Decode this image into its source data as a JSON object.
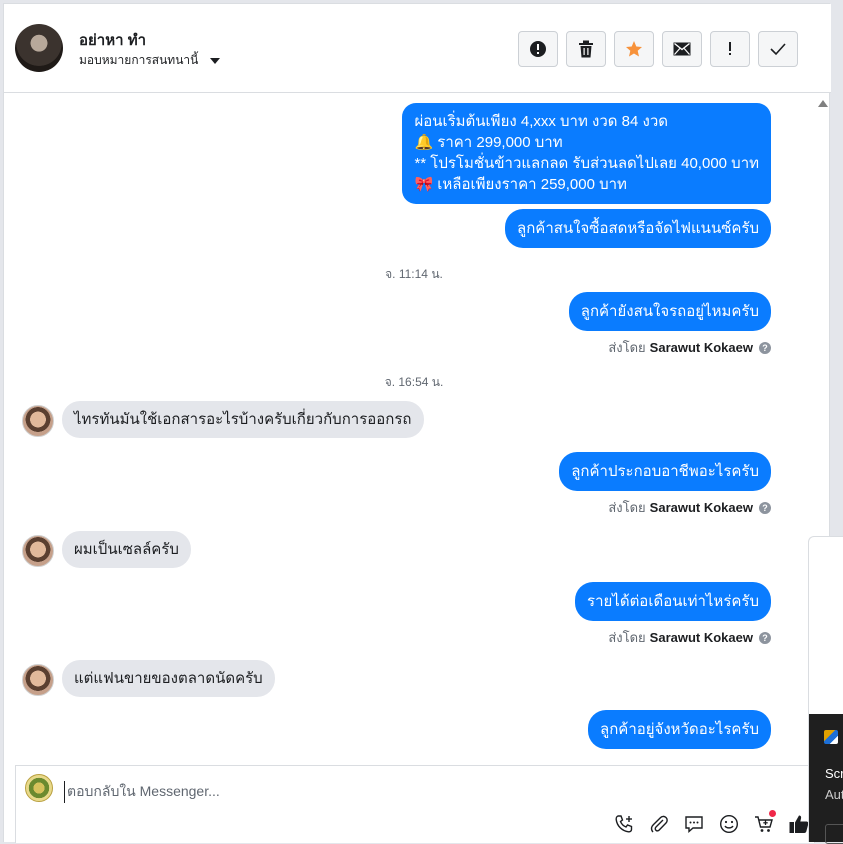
{
  "header": {
    "name": "อย่าหา ทำ",
    "subtitle": "มอบหมายการสนทนานี้",
    "tools": [
      {
        "name": "report-button",
        "icon": "exclamation-circle-icon"
      },
      {
        "name": "delete-button",
        "icon": "trash-icon"
      },
      {
        "name": "star-button",
        "icon": "star-icon"
      },
      {
        "name": "mark-unread-button",
        "icon": "envelope-icon"
      },
      {
        "name": "flag-button",
        "icon": "exclamation-icon"
      },
      {
        "name": "done-button",
        "icon": "checkmark-icon"
      }
    ],
    "colors": {
      "star": "#f7923b"
    }
  },
  "messages": [
    {
      "dir": "out",
      "lines": [
        "ผ่อนเริ่มต้นเพียง 4,xxx บาท งวด 84 งวด",
        "🔔 ราคา 299,000 บาท",
        "** โปรโมชั่นข้าวแลกลด รับส่วนลดไปเลย 40,000 บาท",
        "🎀  เหลือเพียงราคา 259,000 บาท"
      ]
    },
    {
      "dir": "out",
      "text": "ลูกค้าสนใจซื้อสดหรือจัดไฟแนนซ์ครับ"
    },
    {
      "dir": "time",
      "text": "จ. 11:14 น."
    },
    {
      "dir": "out",
      "text": "ลูกค้ายังสนใจรถอยู่ไหมครับ"
    },
    {
      "dir": "sentby",
      "prefix": "ส่งโดย",
      "who": "Sarawut Kokaew"
    },
    {
      "dir": "time",
      "text": "จ. 16:54 น."
    },
    {
      "dir": "in",
      "text": "ไทรทันมันใช้เอกสารอะไรบ้างครับเกี่ยวกับการออกรถ"
    },
    {
      "dir": "out",
      "text": "ลูกค้าประกอบอาชีพอะไรครับ"
    },
    {
      "dir": "sentby",
      "prefix": "ส่งโดย",
      "who": "Sarawut Kokaew"
    },
    {
      "dir": "in",
      "text": "ผมเป็นเซลล์ครับ"
    },
    {
      "dir": "out",
      "text": "รายได้ต่อเดือนเท่าไหร่ครับ"
    },
    {
      "dir": "sentby",
      "prefix": "ส่งโดย",
      "who": "Sarawut Kokaew"
    },
    {
      "dir": "in",
      "text": "แต่แฟนขายของตลาดนัดครับ"
    },
    {
      "dir": "out",
      "text": "ลูกค้าอยู่จังหวัดอะไรครับ"
    }
  ],
  "composer": {
    "placeholder": "ตอบกลับใน Messenger...",
    "icons": [
      "phone-add-icon",
      "paperclip-icon",
      "chat-bubble-icon",
      "emoji-icon",
      "cart-icon",
      "thumbs-up-icon"
    ]
  },
  "side": {
    "line1": "Scr",
    "line2": "Aut"
  },
  "colors": {
    "outgoing_bubble": "#0a7cff",
    "incoming_bubble": "#e4e6eb"
  }
}
